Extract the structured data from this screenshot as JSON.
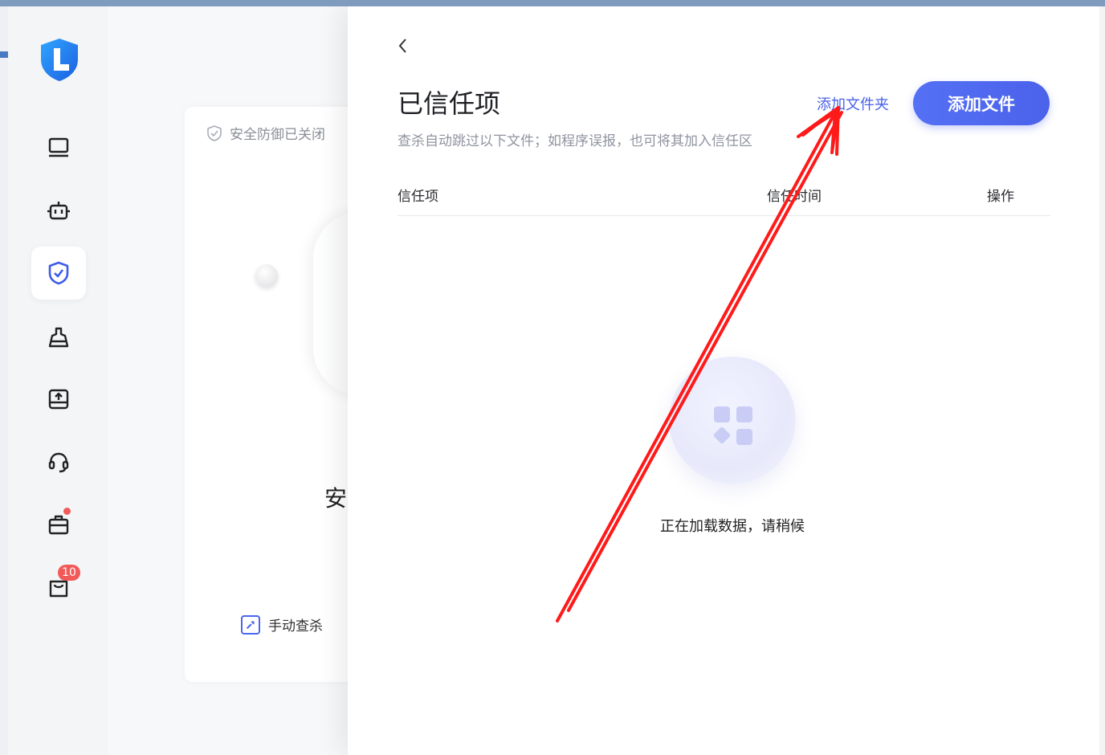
{
  "sidebar": {
    "items": [
      {
        "name": "computer"
      },
      {
        "name": "robot"
      },
      {
        "name": "shield",
        "active": true
      },
      {
        "name": "broom"
      },
      {
        "name": "upload-box"
      },
      {
        "name": "headset"
      },
      {
        "name": "toolbox",
        "dot": true
      },
      {
        "name": "bag",
        "badge": "10"
      }
    ]
  },
  "card": {
    "status_text": "安全防御已关闭",
    "big_char": "安",
    "manual_scan": "手动查杀"
  },
  "panel": {
    "title": "已信任项",
    "subtitle": "查杀自动跳过以下文件；如程序误报，也可将其加入信任区",
    "add_folder": "添加文件夹",
    "add_file": "添加文件",
    "columns": [
      "信任项",
      "信任时间",
      "操作"
    ],
    "loading_text": "正在加载数据，请稍候"
  },
  "colors": {
    "accent": "#4b62ea",
    "badge": "#f25a5a",
    "annotation_arrow": "#ff1a1a"
  }
}
